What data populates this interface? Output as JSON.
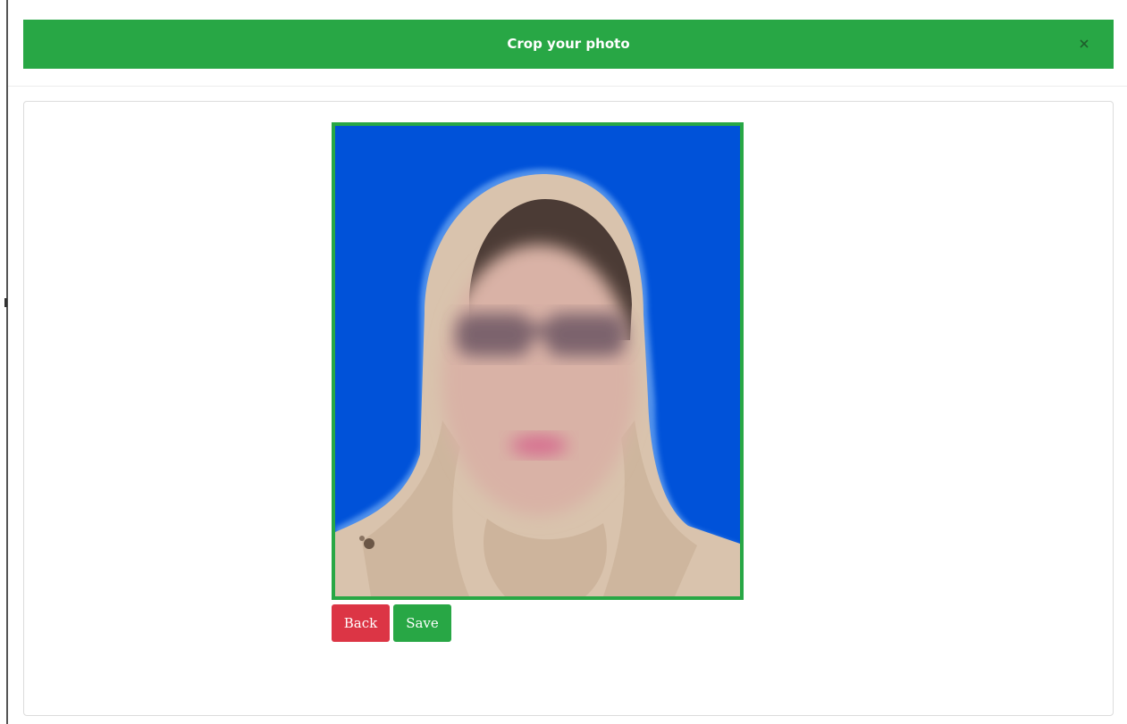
{
  "modal": {
    "title": "Crop your photo",
    "close_icon": "close-icon"
  },
  "photo": {
    "background_color": "#0052d9",
    "frame_color": "#28a745"
  },
  "actions": {
    "back_label": "Back",
    "save_label": "Save"
  },
  "colors": {
    "header": "#28a745",
    "back": "#dc3545",
    "save": "#28a745"
  }
}
